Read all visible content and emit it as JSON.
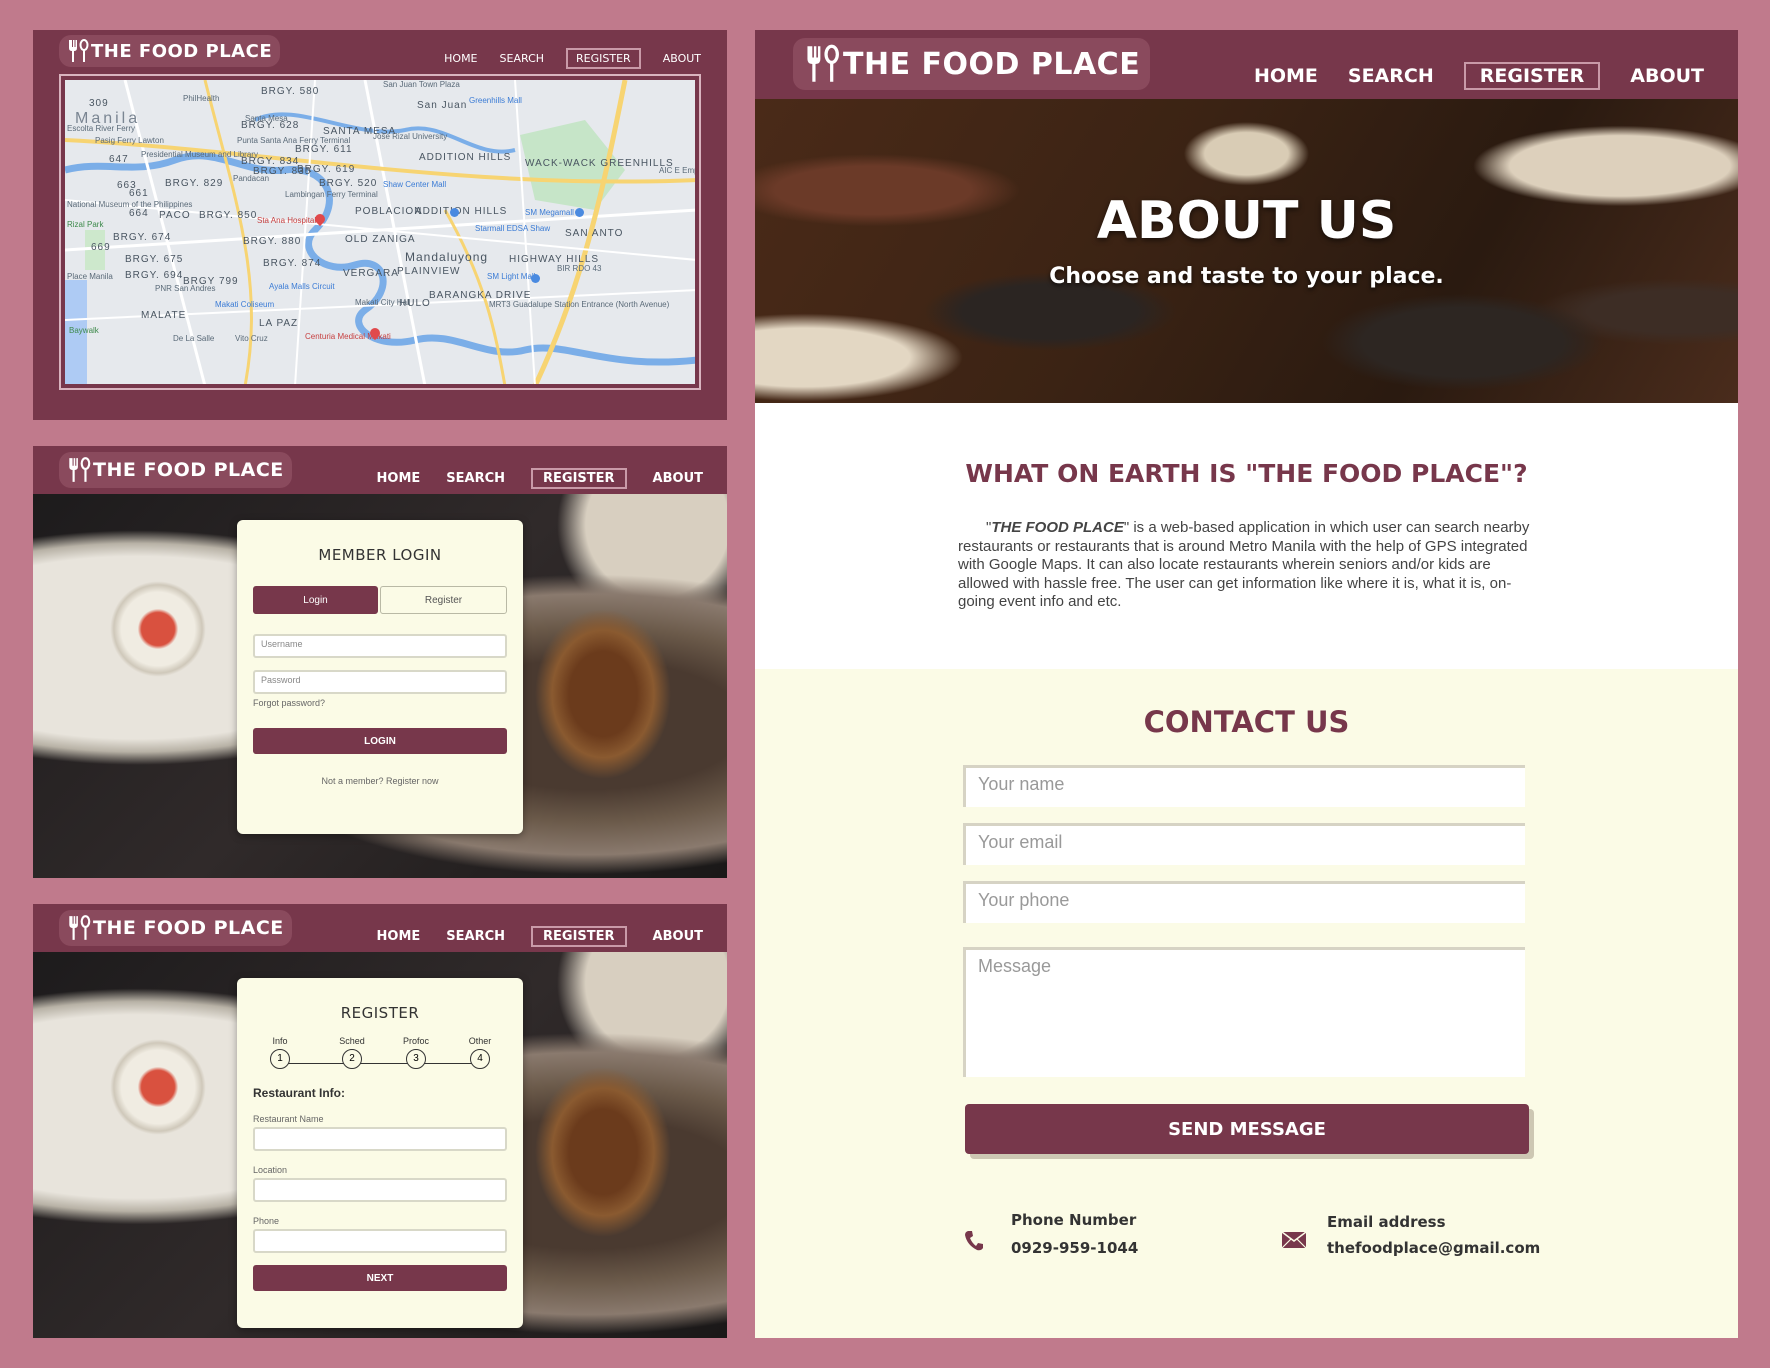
{
  "brand": {
    "name": "THE FOOD PLACE"
  },
  "nav": {
    "home": "HOME",
    "search": "SEARCH",
    "register": "REGISTER",
    "about": "ABOUT"
  },
  "map": {
    "labels": {
      "manila": "Manila",
      "san_juan": "San Juan",
      "santa_mesa": "SANTA MESA",
      "addition_hills": "ADDITION HILLS",
      "wack_wack": "WACK-WACK GREENHILLS",
      "mandaluyong": "Mandaluyong",
      "san_antonio": "SAN ANTO",
      "poblacion": "POBLACION",
      "old_zaniga": "OLD ZANIGA",
      "plainview": "PLAINVIEW",
      "vergara": "VERGARA",
      "highway_hills": "HIGHWAY HILLS",
      "barangka": "BARANGKA DRIVE",
      "hulo": "HULO",
      "la_paz": "LA PAZ",
      "malate": "MALATE",
      "paco": "PACO",
      "sta_ana": "Sta Ana Hospital",
      "makati_coliseum": "Makati Coliseum",
      "shaw": "Shaw Center Mall",
      "sm_megamall": "SM Megamall",
      "starmall": "Starmall EDSA Shaw",
      "sm_light": "SM Light Mall",
      "greenhills": "Greenhills Mall",
      "ayala": "Ayala Malls Circuit",
      "makati_city_hall": "Makati City Hall",
      "jose_rizal": "Jose Rizal University",
      "museum": "Presidential Museum and Library",
      "national_museum": "National Museum of the Philippines",
      "philhealth": "PhilHealth",
      "santa_mesa_s": "Santa Mesa",
      "punta": "Punta Santa Ana Ferry Terminal",
      "lambingan": "Lambingan Ferry Terminal",
      "pandacan": "Pandacan",
      "mrt": "MRT3 Guadalupe Station Entrance (North Avenue)",
      "centuria": "Centuria Medical Makati",
      "de_la_salle": "De La Salle",
      "vito_cruz": "Vito Cruz",
      "baywalk": "Baywalk",
      "pnr": "PNR San Andres",
      "escolta": "Escolta River Ferry",
      "pasig": "Pasig Ferry Lawton",
      "rizal_park": "Rizal Park",
      "place_manila": "Place Manila",
      "san_juan_town": "San Juan Town Plaza",
      "brgy_580": "BRGY. 580",
      "brgy_628": "BRGY. 628",
      "brgy_611": "BRGY. 611",
      "brgy_834": "BRGY. 834",
      "brgy_835": "BRGY. 835",
      "brgy_619": "BRGY. 619",
      "brgy_829": "BRGY. 829",
      "brgy_850": "BRGY. 850",
      "brgy_880": "BRGY. 880",
      "brgy_874": "BRGY. 874",
      "brgy_674": "BRGY. 674",
      "brgy_675": "BRGY. 675",
      "brgy_694": "BRGY. 694",
      "brgy_799": "BRGY 799",
      "brgy_520": "BRGY. 520",
      "brgy_664": "664",
      "brgy_669": "669",
      "brgy_663": "663",
      "brgy_647": "647",
      "brgy_309": "309",
      "brgy_661": "661",
      "aic": "AIC E Emp",
      "bir": "BIR RDO 43"
    }
  },
  "login": {
    "title": "MEMBER LOGIN",
    "tab_login": "Login",
    "tab_register": "Register",
    "username_placeholder": "Username",
    "password_placeholder": "Password",
    "forgot": "Forgot password?",
    "button": "LOGIN",
    "footer": "Not a member? Register now"
  },
  "register": {
    "title": "REGISTER",
    "steps": [
      {
        "label": "Info",
        "num": "1"
      },
      {
        "label": "Sched",
        "num": "2"
      },
      {
        "label": "Profoc",
        "num": "3"
      },
      {
        "label": "Other",
        "num": "4"
      }
    ],
    "section": "Restaurant Info:",
    "field1": "Restaurant Name",
    "field2": "Location",
    "field3": "Phone",
    "button": "NEXT"
  },
  "about": {
    "hero_title": "ABOUT US",
    "hero_sub": "Choose and taste to your place.",
    "what_title": "WHAT ON EARTH IS \"THE FOOD PLACE\"?",
    "what_quote_open": "\"",
    "what_brand": "THE FOOD PLACE",
    "what_body": "\" is a web-based application in which user can search nearby restaurants or restaurants that is around Metro Manila with the help of GPS integrated with Google Maps. It can also locate restaurants wherein seniors and/or kids are allowed with hassle free. The user can get information like where it is, what it is, on-going event info and etc.",
    "contact_title": "CONTACT US",
    "name_placeholder": "Your name",
    "email_placeholder": "Your email",
    "phone_placeholder": "Your phone",
    "message_placeholder": "Message",
    "send": "SEND MESSAGE",
    "phone_label": "Phone Number",
    "phone_value": "0929-959-1044",
    "email_label": "Email address",
    "email_value": "thefoodplace@gmail.com"
  },
  "colors": {
    "brand": "#77374b",
    "background": "#c07a8c",
    "cream": "#fbfbe6"
  }
}
